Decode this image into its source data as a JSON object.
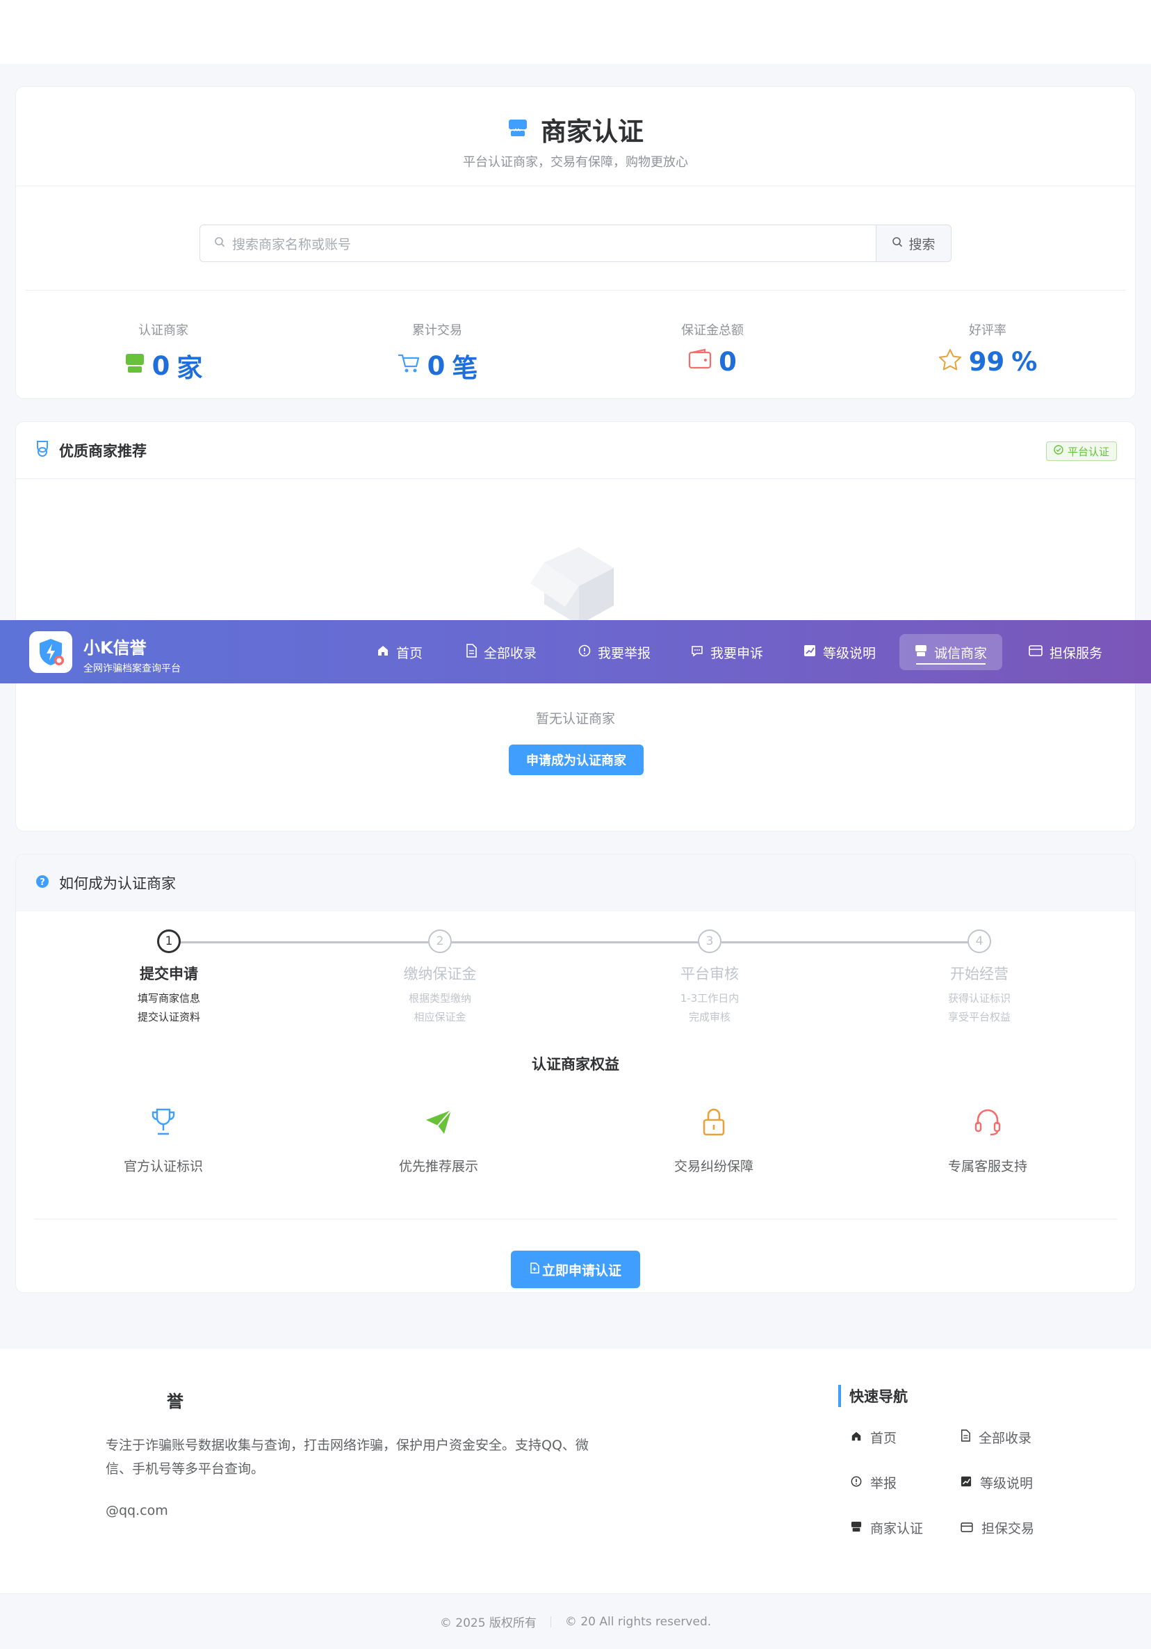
{
  "header": {
    "title": "商家认证",
    "subtitle": "平台认证商家，交易有保障，购物更放心"
  },
  "search": {
    "placeholder": "搜索商家名称或账号",
    "button_label": "搜索"
  },
  "stats": [
    {
      "label": "认证商家",
      "value": "0",
      "unit": "家",
      "icon": "store-icon"
    },
    {
      "label": "累计交易",
      "value": "0",
      "unit": "笔",
      "icon": "cart-icon"
    },
    {
      "label": "保证金总额",
      "value": "0",
      "unit": "",
      "icon": "wallet-icon"
    },
    {
      "label": "好评率",
      "value": "99",
      "unit": "%",
      "icon": "star-icon"
    }
  ],
  "featured": {
    "title": "优质商家推荐",
    "tag": "平台认证",
    "empty_text": "暂无认证商家",
    "apply_label": "申请成为认证商家"
  },
  "nav": {
    "brand_name": "小K信誉",
    "brand_sub": "全网诈骗档案查询平台",
    "items": [
      {
        "label": "首页",
        "icon": "home-icon"
      },
      {
        "label": "全部收录",
        "icon": "document-icon"
      },
      {
        "label": "我要举报",
        "icon": "alert-icon"
      },
      {
        "label": "我要申诉",
        "icon": "chat-icon"
      },
      {
        "label": "等级说明",
        "icon": "chart-icon"
      },
      {
        "label": "诚信商家",
        "icon": "store-icon",
        "active": true
      },
      {
        "label": "担保服务",
        "icon": "card-icon"
      }
    ]
  },
  "howto": {
    "title": "如何成为认证商家",
    "steps": [
      {
        "num": "1",
        "title": "提交申请",
        "line1": "填写商家信息",
        "line2": "提交认证资料"
      },
      {
        "num": "2",
        "title": "缴纳保证金",
        "line1": "根据类型缴纳",
        "line2": "相应保证金"
      },
      {
        "num": "3",
        "title": "平台审核",
        "line1": "1-3工作日内",
        "line2": "完成审核"
      },
      {
        "num": "4",
        "title": "开始经营",
        "line1": "获得认证标识",
        "line2": "享受平台权益"
      }
    ],
    "benefits_title": "认证商家权益",
    "benefits": [
      {
        "label": "官方认证标识",
        "icon": "trophy-icon",
        "color": "#409eff"
      },
      {
        "label": "优先推荐展示",
        "icon": "paper-plane-icon",
        "color": "#67c23a"
      },
      {
        "label": "交易纠纷保障",
        "icon": "lock-icon",
        "color": "#e6a23c"
      },
      {
        "label": "专属客服支持",
        "icon": "headset-icon",
        "color": "#f56c6c"
      }
    ],
    "apply_label": "立即申请认证"
  },
  "footer": {
    "brand": "誉",
    "desc": "专注于诈骗账号数据收集与查询，打击网络诈骗，保护用户资金安全。支持QQ、微信、手机号等多平台查询。",
    "email": "@qq.com",
    "nav_title": "快速导航",
    "links": [
      {
        "label": "首页",
        "icon": "home-icon"
      },
      {
        "label": "全部收录",
        "icon": "document-icon"
      },
      {
        "label": "举报",
        "icon": "alert-icon"
      },
      {
        "label": "等级说明",
        "icon": "chart-icon"
      },
      {
        "label": "商家认证",
        "icon": "store-icon"
      },
      {
        "label": "担保交易",
        "icon": "card-icon"
      }
    ],
    "copyright_left": "© 2025 版权所有",
    "copyright_right": "© 20 All rights reserved."
  },
  "colors": {
    "primary": "#409eff",
    "stat_value": "#1f6fdb",
    "success": "#67c23a",
    "nav_gradient_start": "#5e73d8",
    "nav_gradient_end": "#7b56b8"
  }
}
